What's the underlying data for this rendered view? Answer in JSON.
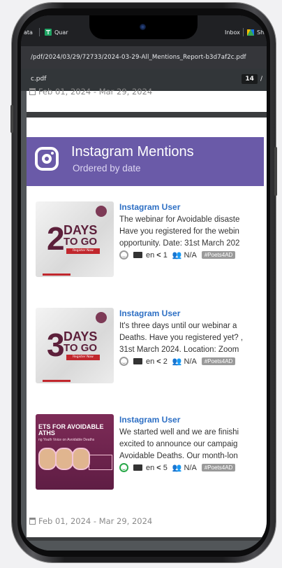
{
  "browser": {
    "tabs": [
      {
        "label": "ata"
      },
      {
        "label": "Quar"
      },
      {
        "label": "Inbox"
      },
      {
        "label": "Sha"
      }
    ],
    "url": "/pdf/2024/03/29/72733/2024-03-29-All_Mentions_Report-b3d7af2c.pdf"
  },
  "pdf_toolbar": {
    "filename": "c.pdf",
    "page": "14",
    "page_sep": "/"
  },
  "report": {
    "date_range_top": "Feb 01, 2024 - Mar 29, 2024",
    "section_title": "Instagram Mentions",
    "section_subtitle": "Ordered by date",
    "mentions": [
      {
        "user": "Instagram User",
        "lines": [
          "The webinar for Avoidable disaste",
          "Have you registered for the webin",
          "opportunity. Date: 31st March 202"
        ],
        "sentiment": "neutral",
        "lang": "en",
        "shares": "1",
        "reach": "N/A",
        "tag": "#Poets4AD",
        "thumb_number": "2",
        "thumb_days": "DAYS",
        "thumb_togo": "TO GO",
        "thumb_register": "Register Now"
      },
      {
        "user": "Instagram User",
        "lines": [
          "It's three days until our webinar a",
          "Deaths. Have you registered yet? ,",
          "31st March 2024. Location: Zoom"
        ],
        "sentiment": "neutral",
        "lang": "en",
        "shares": "2",
        "reach": "N/A",
        "tag": "#Poets4AD",
        "thumb_number": "3",
        "thumb_days": "DAYS",
        "thumb_togo": "TO GO",
        "thumb_register": "Register Now"
      },
      {
        "user": "Instagram User",
        "lines": [
          "We started well and we are finishi",
          "excited to announce our campaig",
          "Avoidable Deaths. Our month-lon"
        ],
        "sentiment": "positive",
        "lang": "en",
        "shares": "5",
        "reach": "N/A",
        "tag": "#Poets4AD",
        "thumb_title": "ETS FOR AVOIDABLE\nATHS",
        "thumb_small": "ng Youth Voice on Avoidable Deaths"
      }
    ],
    "date_range_bottom": "Feb 01, 2024 - Mar 29, 2024"
  },
  "colors": {
    "banner": "#6a5aa8",
    "username": "#2d6fc4",
    "positive": "#2aa84a",
    "neutral": "#9a9a9a"
  }
}
